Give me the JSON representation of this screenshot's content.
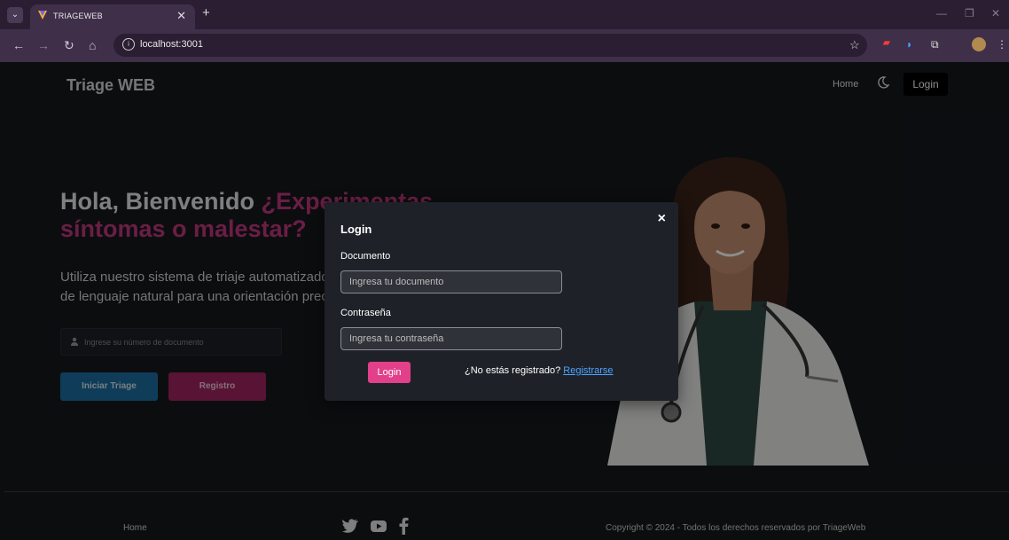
{
  "browser": {
    "tab_title": "TRIAGEWEB",
    "tab_close": "✕",
    "new_tab": "+",
    "menu_glyph": "⌄",
    "url": "localhost:3001",
    "nav": {
      "back": "←",
      "forward": "→",
      "reload": "↻",
      "home": "⌂"
    },
    "bookmark_glyph": "☆"
  },
  "navbar": {
    "brand": "Triage WEB",
    "home": "Home",
    "login": "Login"
  },
  "hero": {
    "title_plain": "Hola, Bienvenido ",
    "title_accent_1": "¿Experimentas",
    "title_accent_2": "síntomas o malestar?",
    "subtitle_line1": "Utiliza nuestro sistema de triaje automatizado",
    "subtitle_line2": "de lenguaje natural para una orientación precisa",
    "doc_placeholder": "Ingrese su número de documento",
    "btn_triage": "Iniciar Triage",
    "btn_registro": "Registro"
  },
  "footer": {
    "home": "Home",
    "copyright": "Copyright © 2024 - Todos los derechos reservados por TriageWeb"
  },
  "modal": {
    "title": "Login",
    "close": "×",
    "documento_label": "Documento",
    "documento_placeholder": "Ingresa tu documento",
    "password_label": "Contraseña",
    "password_placeholder": "Ingresa tu contraseña",
    "login_button": "Login",
    "no_registrado": "¿No estás registrado? ",
    "registrarse": "Registrarse"
  },
  "colors": {
    "accent_pink": "#c2377f",
    "button_blue": "#1d6ea0",
    "link_blue": "#4ea3ff",
    "modal_bg": "#1e2228"
  }
}
